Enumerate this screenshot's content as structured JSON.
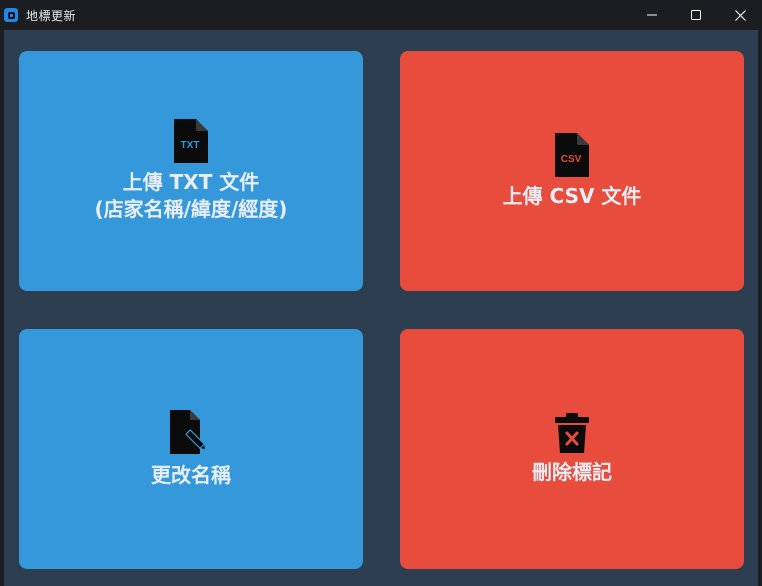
{
  "window": {
    "title": "地標更新",
    "controls": {
      "minimize_icon": "minimize-icon",
      "maximize_icon": "maximize-icon",
      "close_icon": "close-icon"
    }
  },
  "cards": [
    {
      "label": "上傳 TXT 文件\n(店家名稱/緯度/經度)",
      "icon": "txt-file-icon",
      "icon_text": "TXT",
      "color": "#3498db"
    },
    {
      "label": "上傳 CSV 文件",
      "icon": "csv-file-icon",
      "icon_text": "CSV",
      "color": "#e74c3c"
    },
    {
      "label": "更改名稱",
      "icon": "file-edit-icon",
      "color": "#3498db"
    },
    {
      "label": "刪除標記",
      "icon": "trash-icon",
      "color": "#e74c3c"
    }
  ],
  "colors": {
    "background": "#2c3e50",
    "titlebar": "#1b1d20",
    "blue": "#3498db",
    "red": "#e74c3c",
    "text": "#e9eef4"
  }
}
